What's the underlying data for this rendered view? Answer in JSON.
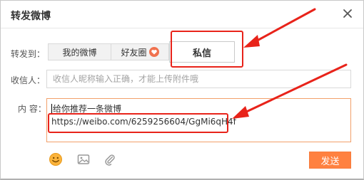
{
  "dialog": {
    "title": "转发微博",
    "close_icon": "close-icon"
  },
  "forward_to": {
    "label": "转发到：",
    "tabs": [
      {
        "label": "我的微博",
        "active": false
      },
      {
        "label": "好友圈",
        "active": false,
        "icon": "heart-icon"
      },
      {
        "label": "私信",
        "active": true
      }
    ]
  },
  "recipient": {
    "label": "收信人：",
    "placeholder": "收信人昵称输入正确，才能上传附件哦",
    "value": ""
  },
  "content": {
    "label": "内  容：",
    "line1": "给你推荐一条微博",
    "line2": "https://weibo.com/6259256604/GgMi6qH4f"
  },
  "toolbar": {
    "icons": [
      "emoji-icon",
      "image-icon",
      "attachment-icon"
    ],
    "send_label": "发送"
  },
  "colors": {
    "accent": "#ff8140",
    "annotation": "#e8231a",
    "content_border": "#f2a06a"
  }
}
